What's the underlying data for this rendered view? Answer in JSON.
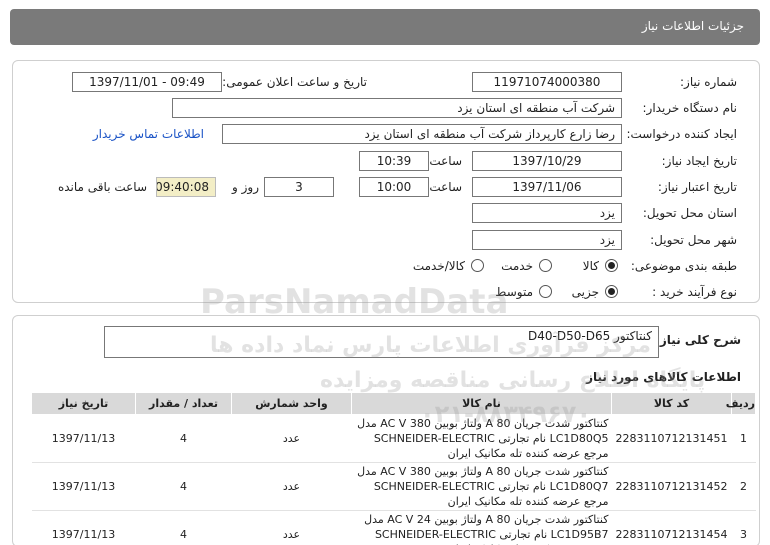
{
  "header": {
    "title": "جزئیات اطلاعات نیاز"
  },
  "form": {
    "need_number_label": "شماره نیاز:",
    "need_number": "11971074000380",
    "announce_label": "تاریخ و ساعت اعلان عمومی:",
    "announce_value": "1397/11/01 - 09:49",
    "buyer_label": "نام دستگاه خریدار:",
    "buyer_value": "شرکت آب منطقه ای استان یزد",
    "creator_label": "ایجاد کننده درخواست:",
    "creator_value": "رضا زارع کارپرداز شرکت آب منطقه ای استان یزد",
    "contact_link": "اطلاعات تماس خریدار",
    "created_date_label": "تاریخ ایجاد نیاز:",
    "created_date": "1397/10/29",
    "time_label": "ساعت",
    "created_time": "10:39",
    "valid_date_label": "تاریخ اعتبار نیاز:",
    "valid_date": "1397/11/06",
    "valid_time": "10:00",
    "days": "3",
    "days_label": "روز و",
    "remaining": "09:40:08",
    "remaining_label": "ساعت باقی مانده",
    "province_label": "استان محل تحویل:",
    "province_value": "یزد",
    "city_label": "شهر محل تحویل:",
    "city_value": "یزد",
    "category_label": "طبقه بندی موضوعی:",
    "category_options": [
      "کالا",
      "خدمت",
      "کالا/خدمت"
    ],
    "process_label": "نوع فرآیند خرید :",
    "process_options": [
      "جزیی",
      "متوسط"
    ]
  },
  "summary": {
    "label": "شرح کلی نیاز:",
    "value": "کنتاکتور D40-D50-D65"
  },
  "items": {
    "title": "اطلاعات کالاهای مورد نیاز",
    "columns": [
      "ردیف",
      "کد کالا",
      "نام کالا",
      "واحد شمارش",
      "تعداد / مقدار",
      "تاریخ نیاز"
    ],
    "rows": [
      {
        "row": "1",
        "code": "2283110712131451",
        "name": "کنتاکتور شدت جریان 80 A ولتاژ بوبین 380 AC V مدل LC1D80Q5 نام تجارتی SCHNEIDER-ELECTRIC مرجع عرضه کننده تله مکانیک ایران",
        "unit": "عدد",
        "qty": "4",
        "date": "1397/11/13"
      },
      {
        "row": "2",
        "code": "2283110712131452",
        "name": "کنتاکتور شدت جریان 80 A ولتاژ بوبین 380 AC V مدل LC1D80Q7 نام تجارتی SCHNEIDER-ELECTRIC مرجع عرضه کننده تله مکانیک ایران",
        "unit": "عدد",
        "qty": "4",
        "date": "1397/11/13"
      },
      {
        "row": "3",
        "code": "2283110712131454",
        "name": "کنتاکتور شدت جریان 80 A ولتاژ بوبین 24 AC V مدل LC1D95B7 نام تجارتی SCHNEIDER-ELECTRIC مرجع عرضه کننده تله مکانیک ایران",
        "unit": "عدد",
        "qty": "4",
        "date": "1397/11/13"
      }
    ]
  },
  "watermark": {
    "brand": "ParsNamadData",
    "line1": "مرکز فرآوری اطلاعات پارس نماد داده ها",
    "line2": "پایگاه اطلاع رسانی مناقصه ومزایده",
    "phone": "۰۲۱-۸۸۳۴۹۶۷۰"
  }
}
